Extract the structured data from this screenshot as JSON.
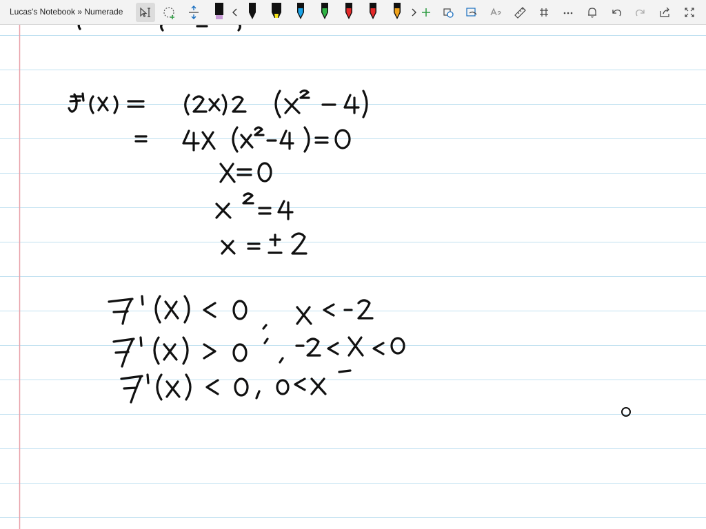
{
  "breadcrumb": "Lucas's Notebook » Numerade",
  "pens": [
    {
      "name": "pen-black",
      "color": "#111111",
      "tip": "#c79ad6",
      "kind": "marker"
    },
    {
      "name": "pen-black-2",
      "color": "#111111",
      "tip": "#111111",
      "kind": "pen"
    },
    {
      "name": "highlighter-yellow",
      "color": "#f6e51a",
      "tip": "#f6e51a",
      "kind": "highlighter"
    },
    {
      "name": "pen-blue",
      "color": "#1aa3e8",
      "tip": "#1aa3e8",
      "kind": "pen"
    },
    {
      "name": "pen-green",
      "color": "#2fb344",
      "tip": "#2fb344",
      "kind": "pen"
    },
    {
      "name": "pen-red",
      "color": "#e52929",
      "tip": "#e52929",
      "kind": "pen"
    },
    {
      "name": "pen-red-pattern",
      "color": "#e52929",
      "tip": "#e52929",
      "kind": "pen"
    },
    {
      "name": "pen-orange",
      "color": "#f1a31a",
      "tip": "#f1a31a",
      "kind": "pen"
    }
  ],
  "ink_color": "#111111",
  "margin_color": "#e8a0a8",
  "rule_color": "#bfe0f0"
}
